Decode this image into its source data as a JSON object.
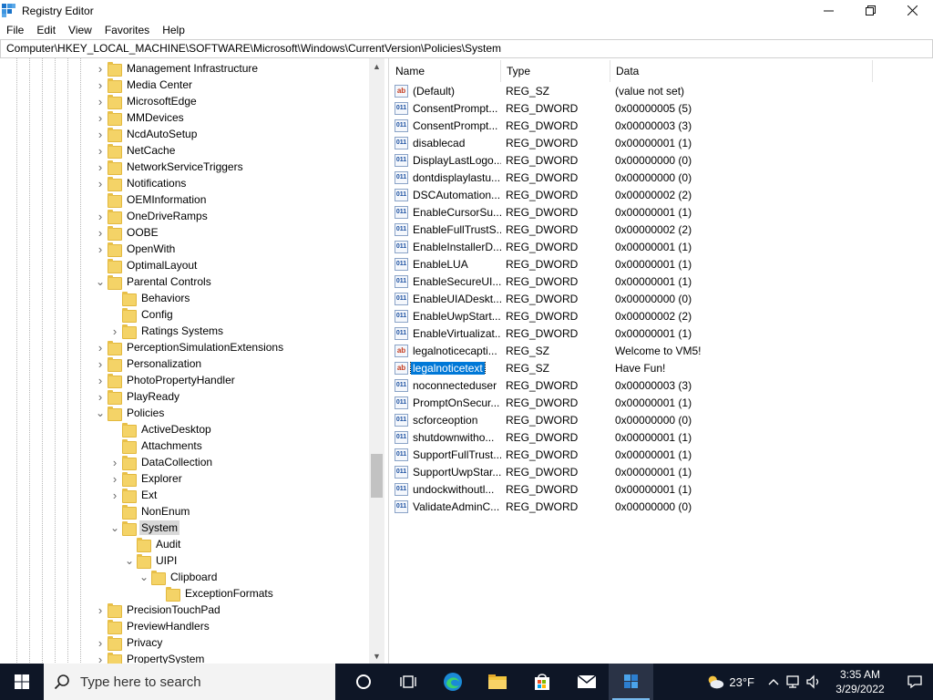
{
  "window": {
    "title": "Registry Editor"
  },
  "menu": [
    "File",
    "Edit",
    "View",
    "Favorites",
    "Help"
  ],
  "address": "Computer\\HKEY_LOCAL_MACHINE\\SOFTWARE\\Microsoft\\Windows\\CurrentVersion\\Policies\\System",
  "tree": [
    {
      "label": "Management Infrastructure",
      "level": 0,
      "expander": "collapsed"
    },
    {
      "label": "Media Center",
      "level": 0,
      "expander": "collapsed"
    },
    {
      "label": "MicrosoftEdge",
      "level": 0,
      "expander": "collapsed"
    },
    {
      "label": "MMDevices",
      "level": 0,
      "expander": "collapsed"
    },
    {
      "label": "NcdAutoSetup",
      "level": 0,
      "expander": "collapsed"
    },
    {
      "label": "NetCache",
      "level": 0,
      "expander": "collapsed"
    },
    {
      "label": "NetworkServiceTriggers",
      "level": 0,
      "expander": "collapsed"
    },
    {
      "label": "Notifications",
      "level": 0,
      "expander": "collapsed"
    },
    {
      "label": "OEMInformation",
      "level": 0,
      "expander": "none"
    },
    {
      "label": "OneDriveRamps",
      "level": 0,
      "expander": "collapsed"
    },
    {
      "label": "OOBE",
      "level": 0,
      "expander": "collapsed"
    },
    {
      "label": "OpenWith",
      "level": 0,
      "expander": "collapsed"
    },
    {
      "label": "OptimalLayout",
      "level": 0,
      "expander": "none"
    },
    {
      "label": "Parental Controls",
      "level": 0,
      "expander": "expanded"
    },
    {
      "label": "Behaviors",
      "level": 1,
      "expander": "none"
    },
    {
      "label": "Config",
      "level": 1,
      "expander": "none"
    },
    {
      "label": "Ratings Systems",
      "level": 1,
      "expander": "collapsed"
    },
    {
      "label": "PerceptionSimulationExtensions",
      "level": 0,
      "expander": "collapsed"
    },
    {
      "label": "Personalization",
      "level": 0,
      "expander": "collapsed"
    },
    {
      "label": "PhotoPropertyHandler",
      "level": 0,
      "expander": "collapsed"
    },
    {
      "label": "PlayReady",
      "level": 0,
      "expander": "collapsed"
    },
    {
      "label": "Policies",
      "level": 0,
      "expander": "expanded"
    },
    {
      "label": "ActiveDesktop",
      "level": 1,
      "expander": "none"
    },
    {
      "label": "Attachments",
      "level": 1,
      "expander": "none"
    },
    {
      "label": "DataCollection",
      "level": 1,
      "expander": "collapsed"
    },
    {
      "label": "Explorer",
      "level": 1,
      "expander": "collapsed"
    },
    {
      "label": "Ext",
      "level": 1,
      "expander": "collapsed"
    },
    {
      "label": "NonEnum",
      "level": 1,
      "expander": "none"
    },
    {
      "label": "System",
      "level": 1,
      "expander": "expanded",
      "selected": true
    },
    {
      "label": "Audit",
      "level": 2,
      "expander": "none"
    },
    {
      "label": "UIPI",
      "level": 2,
      "expander": "expanded"
    },
    {
      "label": "Clipboard",
      "level": 3,
      "expander": "expanded"
    },
    {
      "label": "ExceptionFormats",
      "level": 4,
      "expander": "none"
    },
    {
      "label": "PrecisionTouchPad",
      "level": 0,
      "expander": "collapsed"
    },
    {
      "label": "PreviewHandlers",
      "level": 0,
      "expander": "none"
    },
    {
      "label": "Privacy",
      "level": 0,
      "expander": "collapsed"
    },
    {
      "label": "PropertySystem",
      "level": 0,
      "expander": "collapsed"
    }
  ],
  "columns": [
    "Name",
    "Type",
    "Data"
  ],
  "values": [
    {
      "name": "(Default)",
      "type": "REG_SZ",
      "data": "(value not set)",
      "kind": "sz"
    },
    {
      "name": "ConsentPrompt...",
      "type": "REG_DWORD",
      "data": "0x00000005 (5)",
      "kind": "bin"
    },
    {
      "name": "ConsentPrompt...",
      "type": "REG_DWORD",
      "data": "0x00000003 (3)",
      "kind": "bin"
    },
    {
      "name": "disablecad",
      "type": "REG_DWORD",
      "data": "0x00000001 (1)",
      "kind": "bin"
    },
    {
      "name": "DisplayLastLogo...",
      "type": "REG_DWORD",
      "data": "0x00000000 (0)",
      "kind": "bin"
    },
    {
      "name": "dontdisplaylastu...",
      "type": "REG_DWORD",
      "data": "0x00000000 (0)",
      "kind": "bin"
    },
    {
      "name": "DSCAutomation...",
      "type": "REG_DWORD",
      "data": "0x00000002 (2)",
      "kind": "bin"
    },
    {
      "name": "EnableCursorSu...",
      "type": "REG_DWORD",
      "data": "0x00000001 (1)",
      "kind": "bin"
    },
    {
      "name": "EnableFullTrustS...",
      "type": "REG_DWORD",
      "data": "0x00000002 (2)",
      "kind": "bin"
    },
    {
      "name": "EnableInstallerD...",
      "type": "REG_DWORD",
      "data": "0x00000001 (1)",
      "kind": "bin"
    },
    {
      "name": "EnableLUA",
      "type": "REG_DWORD",
      "data": "0x00000001 (1)",
      "kind": "bin"
    },
    {
      "name": "EnableSecureUI...",
      "type": "REG_DWORD",
      "data": "0x00000001 (1)",
      "kind": "bin"
    },
    {
      "name": "EnableUIADeskt...",
      "type": "REG_DWORD",
      "data": "0x00000000 (0)",
      "kind": "bin"
    },
    {
      "name": "EnableUwpStart...",
      "type": "REG_DWORD",
      "data": "0x00000002 (2)",
      "kind": "bin"
    },
    {
      "name": "EnableVirtualizat...",
      "type": "REG_DWORD",
      "data": "0x00000001 (1)",
      "kind": "bin"
    },
    {
      "name": "legalnoticecapti...",
      "type": "REG_SZ",
      "data": "Welcome to VM5!",
      "kind": "sz"
    },
    {
      "name": "legalnoticetext",
      "type": "REG_SZ",
      "data": "Have Fun!",
      "kind": "sz",
      "selected": true
    },
    {
      "name": "noconnecteduser",
      "type": "REG_DWORD",
      "data": "0x00000003 (3)",
      "kind": "bin"
    },
    {
      "name": "PromptOnSecur...",
      "type": "REG_DWORD",
      "data": "0x00000001 (1)",
      "kind": "bin"
    },
    {
      "name": "scforceoption",
      "type": "REG_DWORD",
      "data": "0x00000000 (0)",
      "kind": "bin"
    },
    {
      "name": "shutdownwitho...",
      "type": "REG_DWORD",
      "data": "0x00000001 (1)",
      "kind": "bin"
    },
    {
      "name": "SupportFullTrust...",
      "type": "REG_DWORD",
      "data": "0x00000001 (1)",
      "kind": "bin"
    },
    {
      "name": "SupportUwpStar...",
      "type": "REG_DWORD",
      "data": "0x00000001 (1)",
      "kind": "bin"
    },
    {
      "name": "undockwithoutl...",
      "type": "REG_DWORD",
      "data": "0x00000001 (1)",
      "kind": "bin"
    },
    {
      "name": "ValidateAdminC...",
      "type": "REG_DWORD",
      "data": "0x00000000 (0)",
      "kind": "bin"
    }
  ],
  "icon_labels": {
    "sz": "ab",
    "bin": "011"
  },
  "taskbar": {
    "search_placeholder": "Type here to search",
    "temperature": "23°F",
    "time": "3:35 AM",
    "date": "3/29/2022",
    "icons": [
      "cortana-icon",
      "task-view-icon",
      "edge-icon",
      "file-explorer-icon",
      "store-icon",
      "mail-icon",
      "regedit-icon"
    ]
  }
}
